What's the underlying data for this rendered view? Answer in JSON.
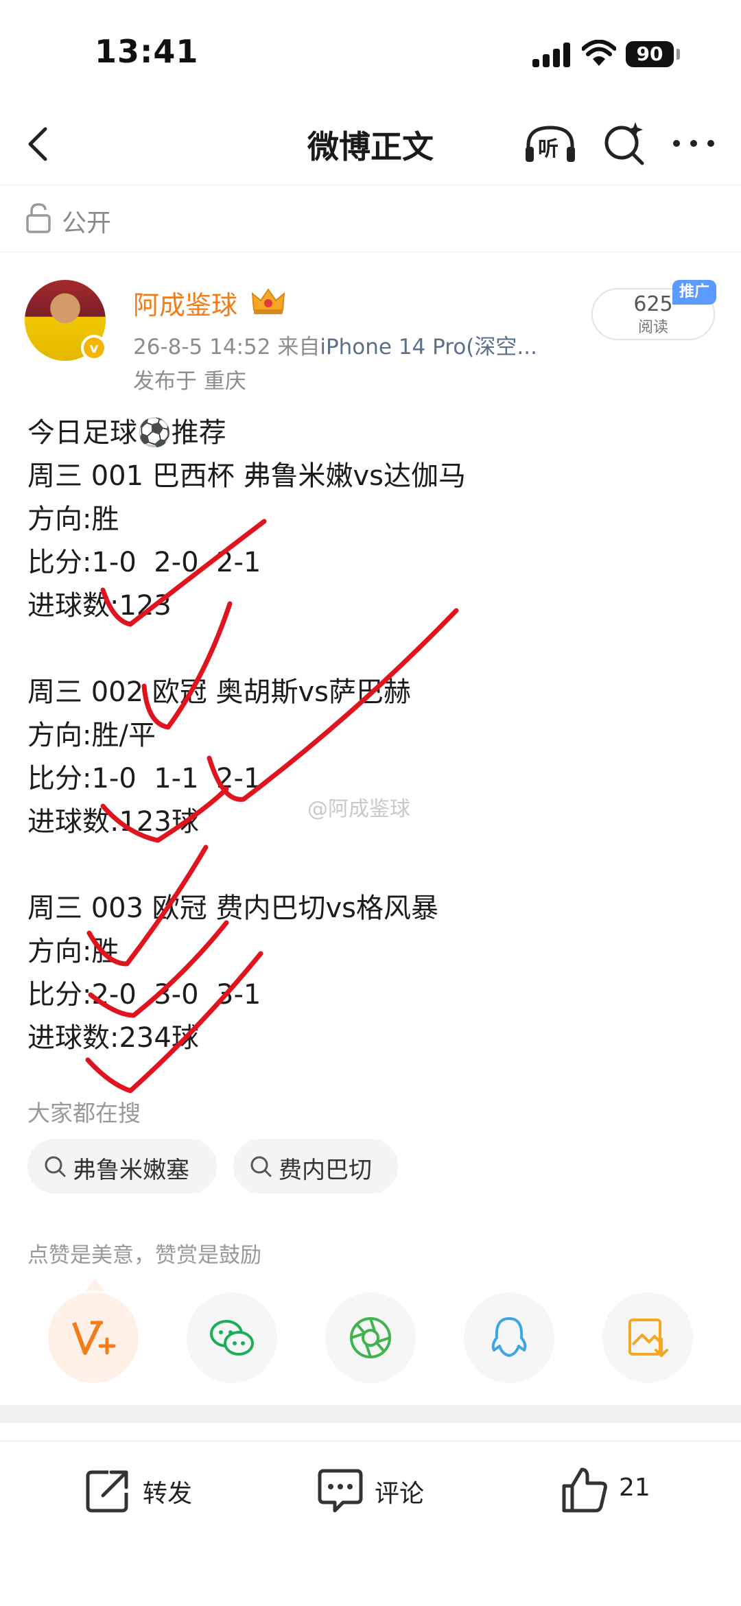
{
  "status_bar": {
    "time": "13:41",
    "battery": "90"
  },
  "nav": {
    "title": "微博正文",
    "listen_label": "听"
  },
  "visibility": {
    "label": "公开"
  },
  "author": {
    "name": "阿成鉴球",
    "date": "26-8-5 14:52",
    "source_prefix": "来自",
    "source": "iPhone 14 Pro(深空...",
    "location": "发布于 重庆",
    "read_count": "625",
    "read_label": "阅读",
    "promo_tag": "推广"
  },
  "post": {
    "lines": [
      "今日足球⚽推荐",
      "周三 001 巴西杯 弗鲁米嫩vs达伽马",
      "方向:胜",
      "比分:1-0  2-0  2-1",
      "进球数:123",
      "",
      "周三 002 欧冠 奥胡斯vs萨巴赫",
      "方向:胜/平",
      "比分:1-0  1-1  2-1",
      "进球数:123球",
      "",
      "周三 003 欧冠 费内巴切vs格风暴",
      "方向:胜",
      "比分:2-0  3-0  3-1",
      "进球数:234球"
    ],
    "watermark": "@阿成鉴球"
  },
  "trending": {
    "heading": "大家都在搜",
    "chips": [
      "弗鲁米嫩塞",
      "费内巴切"
    ]
  },
  "reward": {
    "text": "点赞是美意，赞赏是鼓励"
  },
  "share_targets": [
    "vip-plus",
    "wechat",
    "moments",
    "qq",
    "save-image"
  ],
  "actions": {
    "repost": "转发",
    "comment": "评论",
    "like_count": "21"
  },
  "colors": {
    "author_orange": "#f07c1a",
    "source_blue": "#5a6f8c",
    "promo_blue": "#5b9bff",
    "check_red": "#e0141e"
  }
}
